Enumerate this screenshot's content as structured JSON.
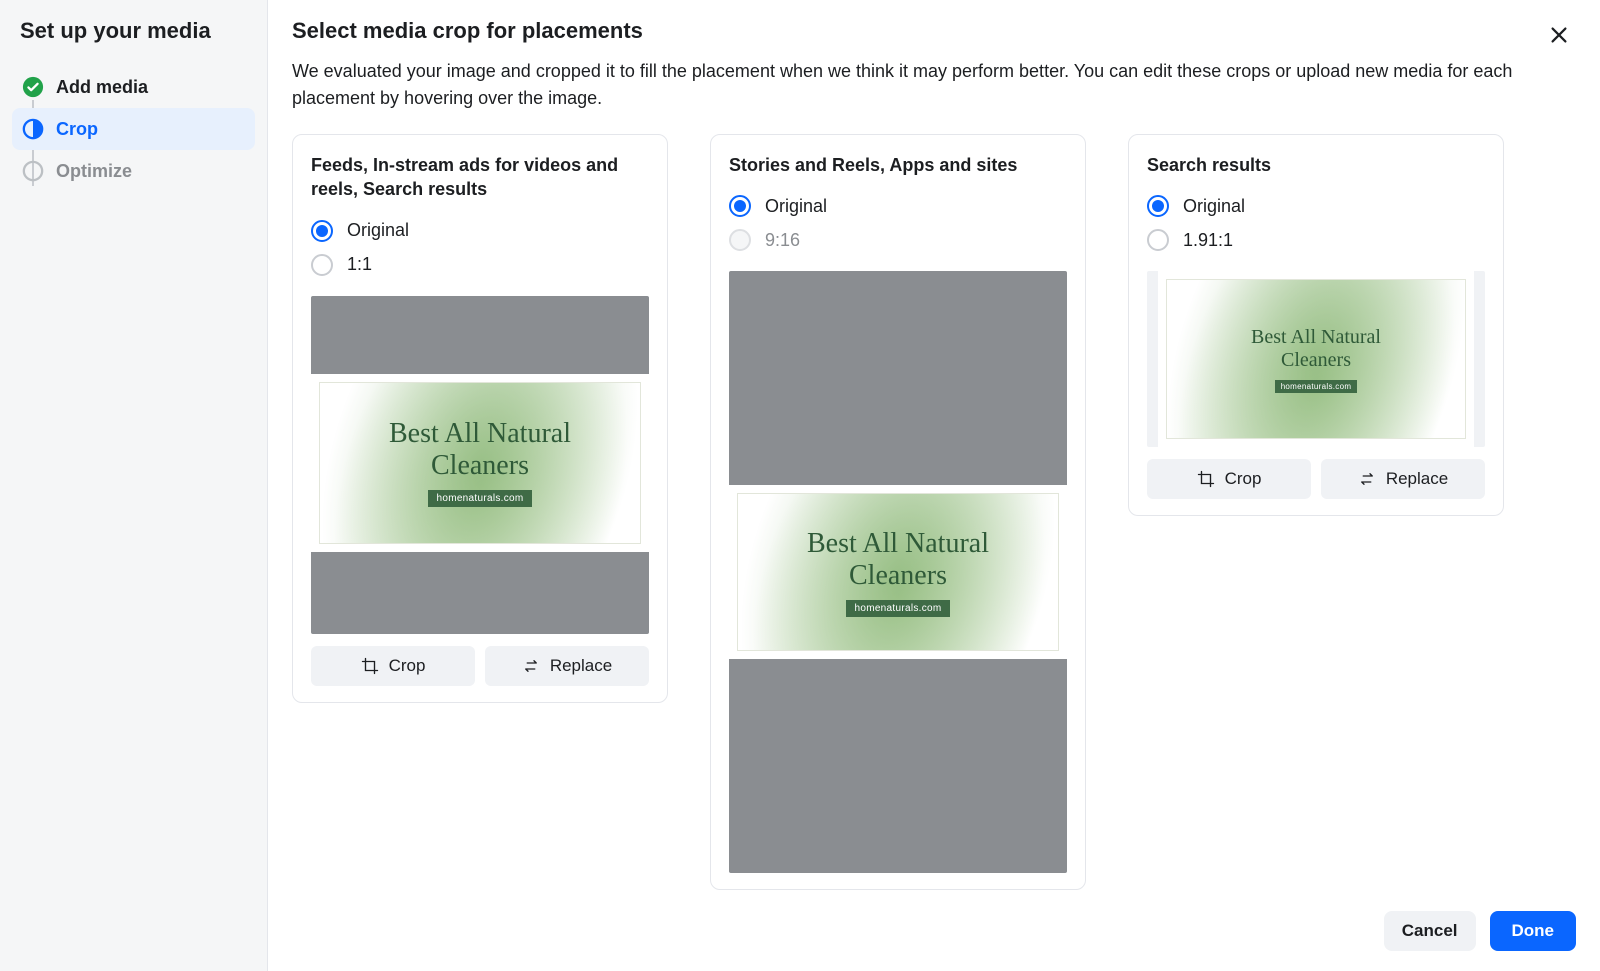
{
  "sidebar": {
    "title": "Set up your media",
    "steps": [
      {
        "label": "Add media",
        "state": "done"
      },
      {
        "label": "Crop",
        "state": "active"
      },
      {
        "label": "Optimize",
        "state": "upcoming"
      }
    ]
  },
  "main": {
    "title": "Select media crop for placements",
    "description": "We evaluated your image and cropped it to fill the placement when we think it may perform better. You can edit these crops or upload new media for each placement by hovering over the image.",
    "creative": {
      "line1": "Best All Natural",
      "line2": "Cleaners",
      "pill": "homenaturals.com"
    },
    "crop_label": "Crop",
    "replace_label": "Replace",
    "cards": [
      {
        "title": "Feeds, In-stream ads for videos and reels, Search results",
        "options": [
          {
            "label": "Original",
            "selected": true,
            "disabled": false
          },
          {
            "label": "1:1",
            "selected": false,
            "disabled": false
          }
        ]
      },
      {
        "title": "Stories and Reels, Apps and sites",
        "options": [
          {
            "label": "Original",
            "selected": true,
            "disabled": false
          },
          {
            "label": "9:16",
            "selected": false,
            "disabled": true
          }
        ]
      },
      {
        "title": "Search results",
        "options": [
          {
            "label": "Original",
            "selected": true,
            "disabled": false
          },
          {
            "label": "1.91:1",
            "selected": false,
            "disabled": false
          }
        ]
      }
    ]
  },
  "footer": {
    "cancel": "Cancel",
    "done": "Done"
  }
}
